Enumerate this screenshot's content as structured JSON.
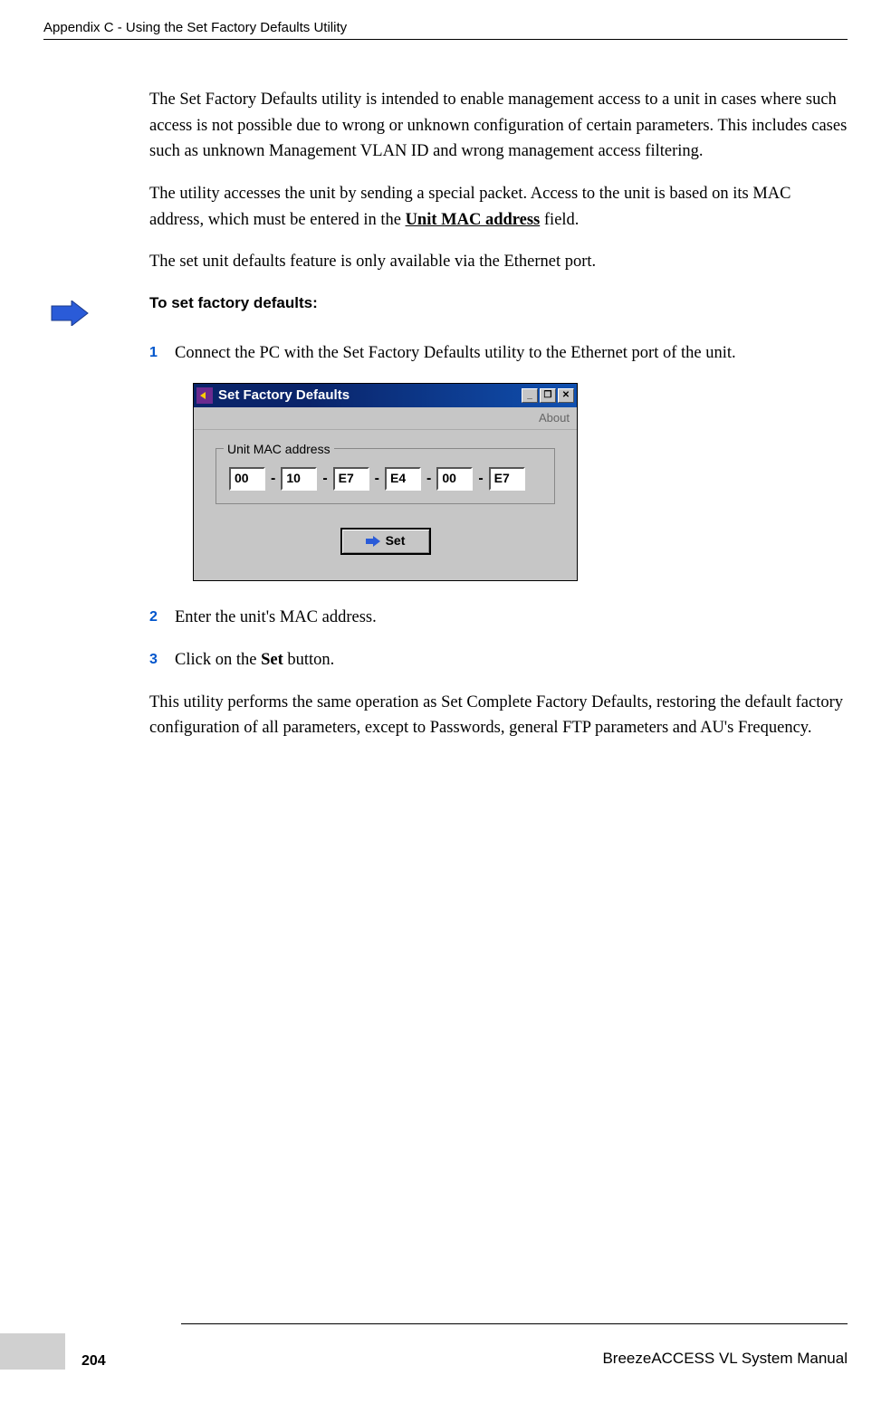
{
  "header": "Appendix C - Using the Set Factory Defaults Utility",
  "p1": "The Set Factory Defaults utility is intended to enable management access to a unit in cases where such access is not possible due to wrong or unknown configuration of certain parameters. This includes cases such as unknown Management VLAN ID and wrong management access filtering.",
  "p2a": "The utility accesses the unit by sending a special packet. Access to the unit is based on its MAC address, which must be entered in the ",
  "p2_bold": "Unit MAC address",
  "p2b": " field.",
  "p3": "The set unit defaults feature is only available via the Ethernet port.",
  "heading": "To set factory defaults:",
  "steps": {
    "s1": {
      "num": "1",
      "text": " Connect the PC with the Set Factory Defaults utility to the Ethernet port of the unit."
    },
    "s2": {
      "num": "2",
      "text": "Enter the unit's MAC address."
    },
    "s3": {
      "num": "3",
      "a": "Click on the ",
      "bold": "Set",
      "b": " button."
    }
  },
  "dialog": {
    "title": "Set Factory Defaults",
    "menu": "About",
    "legend": "Unit MAC address",
    "mac": [
      "00",
      "10",
      "E7",
      "E4",
      "00",
      "E7"
    ],
    "dash": "-",
    "set_label": "Set",
    "win": {
      "min": "_",
      "max": "❐",
      "close": "✕"
    }
  },
  "p4": "This utility performs the same operation as Set Complete Factory Defaults, restoring the default factory configuration of all parameters, except to Passwords, general FTP parameters and AU's Frequency.",
  "footer": {
    "page": "204",
    "title": "BreezeACCESS VL System Manual"
  }
}
